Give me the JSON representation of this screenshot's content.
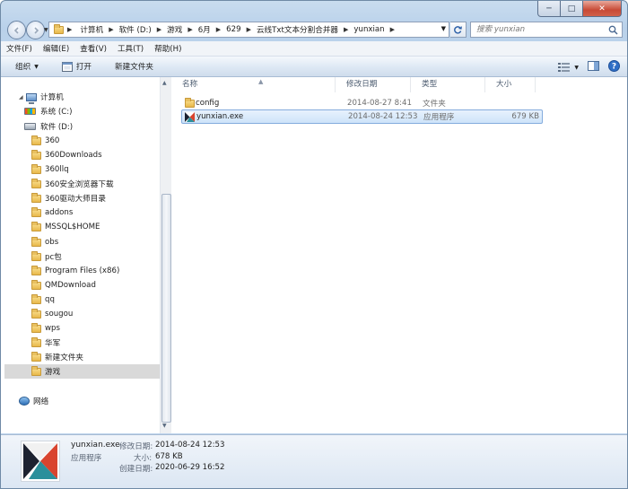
{
  "window": {
    "caption_min": "─",
    "caption_max": "□",
    "caption_close": "✕"
  },
  "address": {
    "crumbs": [
      "计算机",
      "软件 (D:)",
      "游戏",
      "6月",
      "629",
      "云线Txt文本分割合并器",
      "yunxian"
    ]
  },
  "search": {
    "placeholder": "搜索 yunxian"
  },
  "menu": [
    "文件(F)",
    "编辑(E)",
    "查看(V)",
    "工具(T)",
    "帮助(H)"
  ],
  "commands": {
    "organize": "组织",
    "open": "打开",
    "new_folder": "新建文件夹"
  },
  "nav": {
    "computer": "计算机",
    "drive_c": "系统 (C:)",
    "drive_d": "软件 (D:)",
    "folders": [
      "360",
      "360Downloads",
      "360llq",
      "360安全浏览器下载",
      "360驱动大师目录",
      "addons",
      "MSSQL$HOME",
      "obs",
      "pc包",
      "Program Files (x86)",
      "QMDownload",
      "qq",
      "sougou",
      "wps",
      "华军",
      "新建文件夹",
      "游戏"
    ],
    "network": "网络"
  },
  "columns": {
    "name": "名称",
    "date": "修改日期",
    "type": "类型",
    "size": "大小"
  },
  "files": [
    {
      "name": "config",
      "date": "2014-08-27 8:41",
      "type": "文件夹",
      "size": ""
    },
    {
      "name": "yunxian.exe",
      "date": "2014-08-24 12:53",
      "type": "应用程序",
      "size": "679 KB"
    }
  ],
  "details": {
    "filename": "yunxian.exe",
    "filetype": "应用程序",
    "modified_label": "修改日期:",
    "modified_value": "2014-08-24 12:53",
    "size_label": "大小:",
    "size_value": "678 KB",
    "created_label": "创建日期:",
    "created_value": "2020-06-29 16:52"
  }
}
